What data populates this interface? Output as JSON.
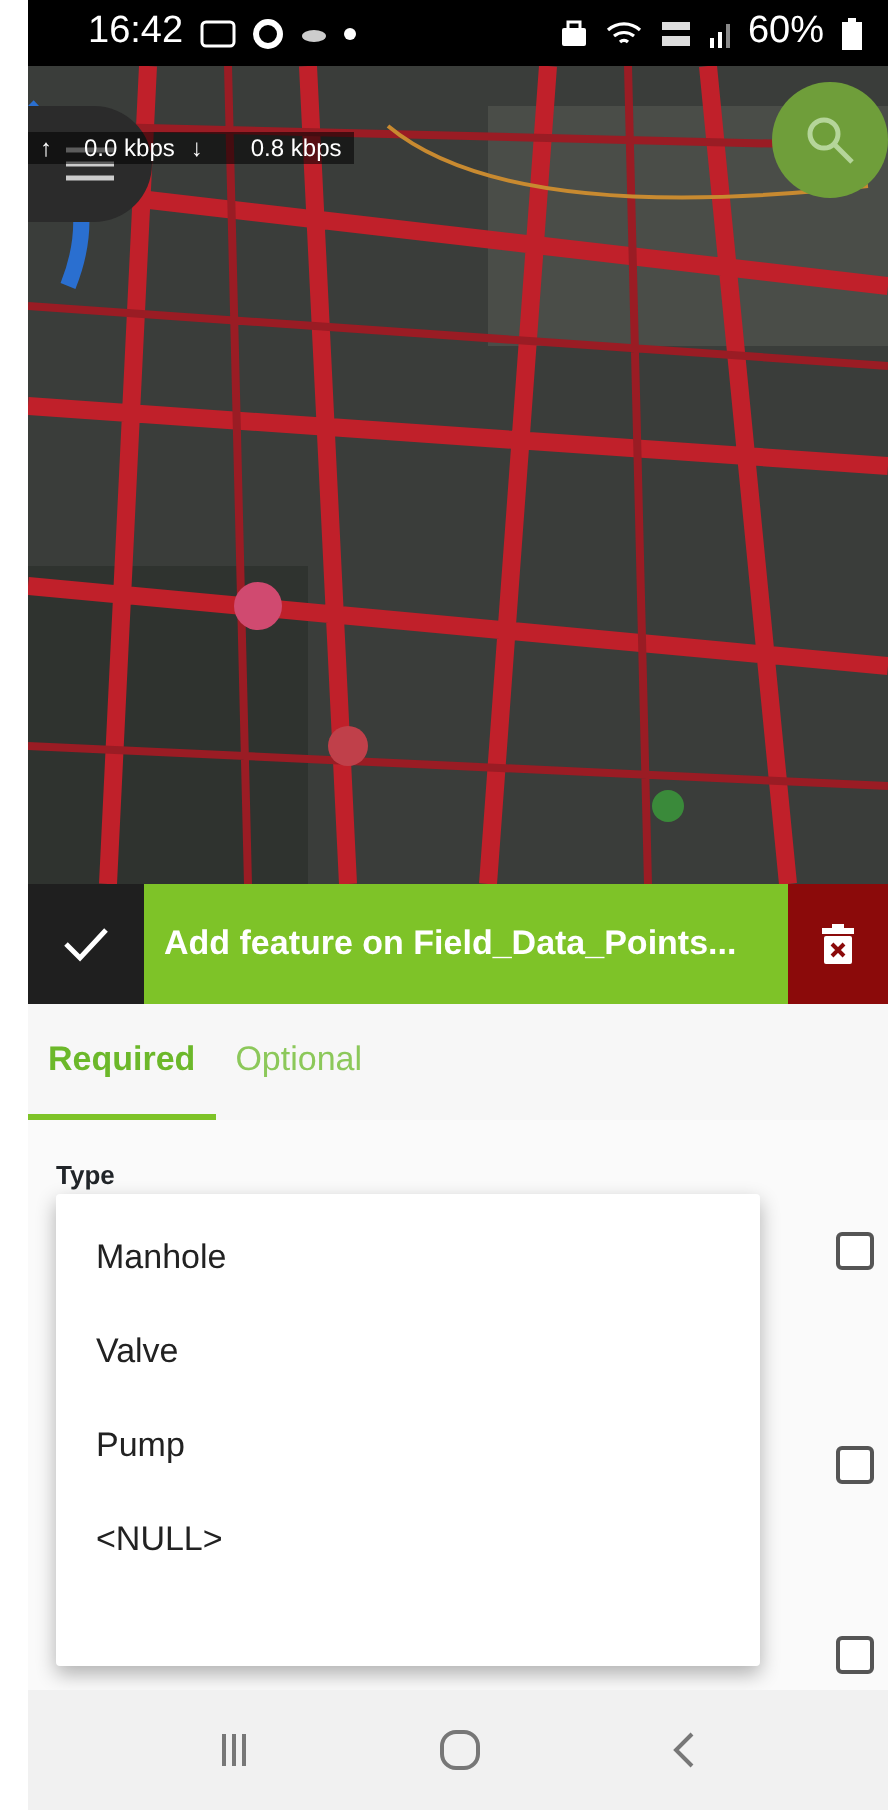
{
  "status_bar": {
    "time": "16:42",
    "battery": "60%",
    "upload_arrow": "↑",
    "upload": "0.0 kbps",
    "download_arrow": "↓",
    "download": "0.8 kbps"
  },
  "action_bar": {
    "title": "Add feature on Field_Data_Points..."
  },
  "tabs": [
    {
      "label": "Required",
      "selected": true
    },
    {
      "label": "Optional",
      "selected": false
    }
  ],
  "form": {
    "field_label": "Type",
    "dropdown": {
      "options": [
        "Manhole",
        "Valve",
        "Pump",
        "<NULL>"
      ]
    },
    "checkboxes": [
      {
        "checked": false
      },
      {
        "checked": false
      },
      {
        "checked": false
      }
    ]
  }
}
